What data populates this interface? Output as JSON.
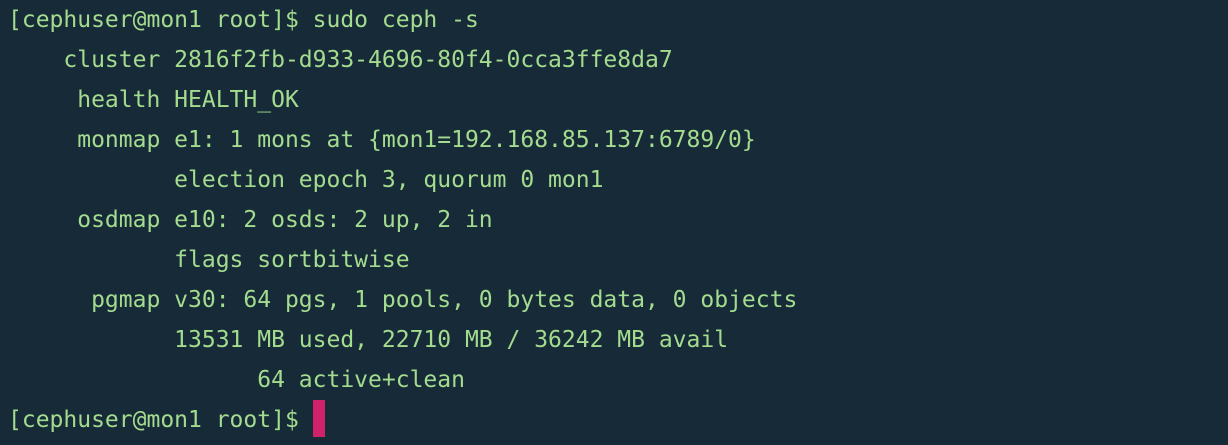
{
  "colors": {
    "background": "#172a38",
    "text": "#a4dc8f",
    "cursor": "#d0226b"
  },
  "terminal": {
    "lines": [
      "[cephuser@mon1 root]$ sudo ceph -s",
      "    cluster 2816f2fb-d933-4696-80f4-0cca3ffe8da7",
      "     health HEALTH_OK",
      "     monmap e1: 1 mons at {mon1=192.168.85.137:6789/0}",
      "            election epoch 3, quorum 0 mon1",
      "     osdmap e10: 2 osds: 2 up, 2 in",
      "            flags sortbitwise",
      "      pgmap v30: 64 pgs, 1 pools, 0 bytes data, 0 objects",
      "            13531 MB used, 22710 MB / 36242 MB avail",
      "                  64 active+clean"
    ],
    "prompt": "[cephuser@mon1 root]$"
  }
}
